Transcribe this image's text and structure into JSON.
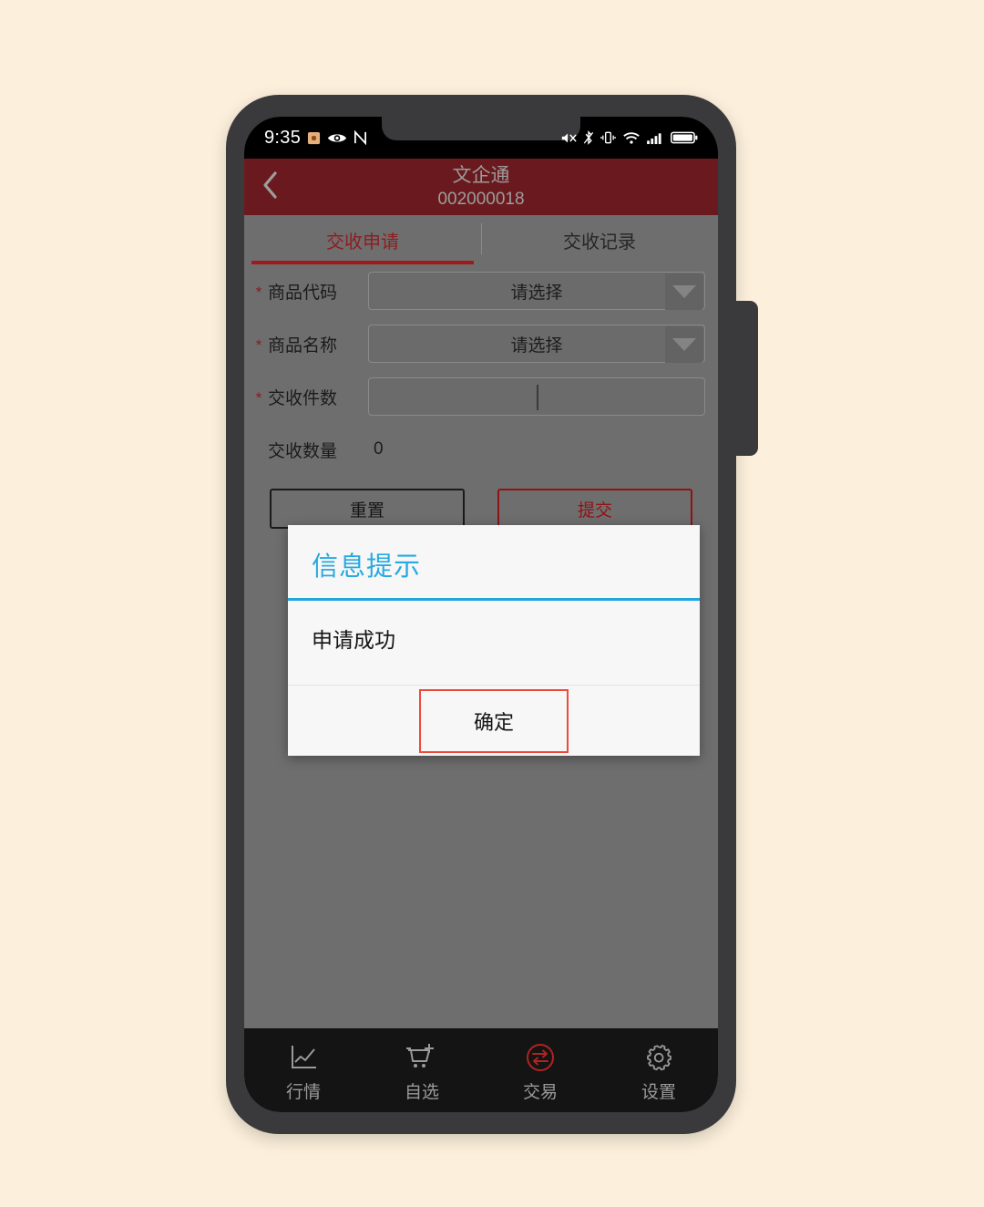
{
  "theme": {
    "page_background": "#fcf0dc",
    "phone_frame": "#3a3a3c",
    "header_red": "#6a1a1e",
    "accent_red": "#a01a1d",
    "dialog_blue": "#27a9e1",
    "dialog_button_border": "#ee4a3b",
    "screen_overlay_gray": "#6e6e6e",
    "nav_background": "#141414"
  },
  "status_bar": {
    "time": "9:35",
    "left_icons": [
      "app-badge-icon",
      "eye-icon",
      "nfc-icon"
    ],
    "right_icons": [
      "mute-icon",
      "bluetooth-off-icon",
      "vibrate-icon",
      "wifi-icon",
      "cellular-signal-icon",
      "battery-icon"
    ]
  },
  "header": {
    "back_icon": "chevron-left-icon",
    "title": "文企通",
    "subtitle": "002000018"
  },
  "tabs": [
    {
      "label": "交收申请",
      "active": true
    },
    {
      "label": "交收记录",
      "active": false
    }
  ],
  "form": {
    "rows": [
      {
        "required": true,
        "required_mark": "*",
        "label": "商品代码",
        "type": "select",
        "value": "",
        "placeholder": "请选择"
      },
      {
        "required": true,
        "required_mark": "*",
        "label": "商品名称",
        "type": "select",
        "value": "",
        "placeholder": "请选择"
      },
      {
        "required": true,
        "required_mark": "*",
        "label": "交收件数",
        "type": "input",
        "value": "",
        "placeholder": ""
      },
      {
        "required": false,
        "required_mark": "*",
        "label": "交收数量",
        "type": "static",
        "value": "0",
        "placeholder": ""
      }
    ],
    "actions": {
      "reset_label": "重置",
      "submit_label": "提交"
    }
  },
  "dialog": {
    "title": "信息提示",
    "message": "申请成功",
    "ok_label": "确定"
  },
  "bottom_nav": [
    {
      "label": "行情",
      "icon": "line-chart-icon",
      "active": false
    },
    {
      "label": "自选",
      "icon": "cart-plus-icon",
      "active": false
    },
    {
      "label": "交易",
      "icon": "exchange-circle-icon",
      "active": true
    },
    {
      "label": "设置",
      "icon": "gear-icon",
      "active": false
    }
  ]
}
